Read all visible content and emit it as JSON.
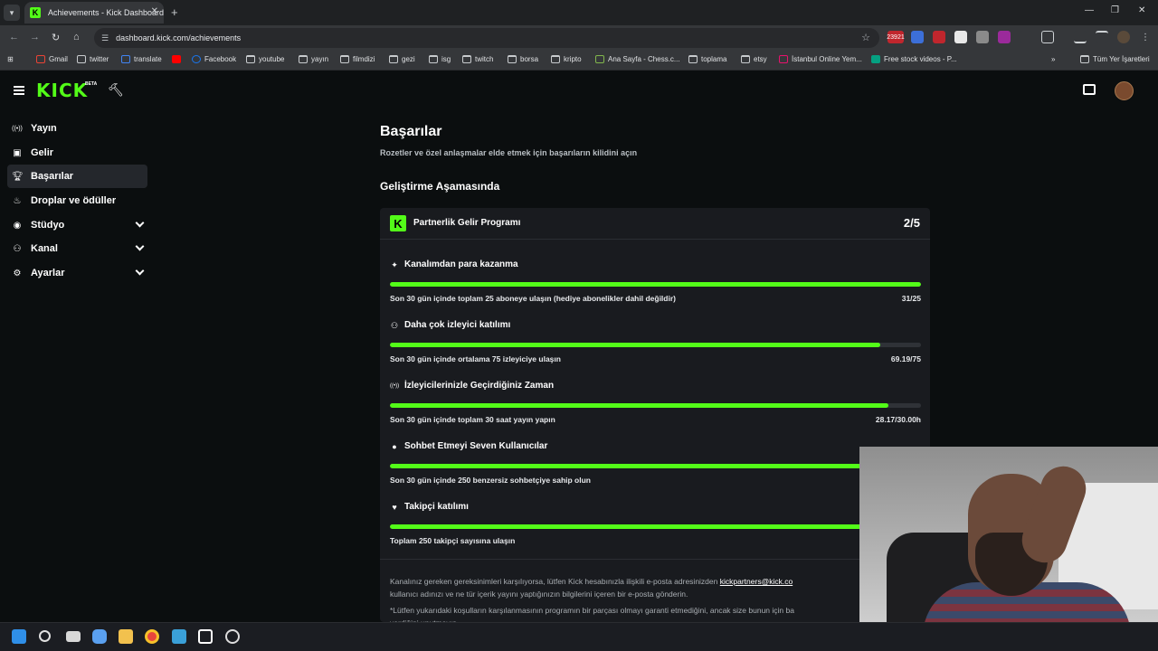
{
  "browser": {
    "tab_title": "Achievements - Kick Dashboard",
    "url": "dashboard.kick.com/achievements",
    "new_tab": "+",
    "close": "✕",
    "window_controls": [
      "—",
      "❐",
      "✕"
    ],
    "extension_badge": "23921",
    "bookmarks": [
      {
        "label": "Gmail",
        "icon": "gmail-icon"
      },
      {
        "label": "twitter",
        "icon": "x-icon"
      },
      {
        "label": "translate",
        "icon": "translate-icon"
      },
      {
        "label": "",
        "icon": "youtube-icon"
      },
      {
        "label": "Facebook",
        "icon": "facebook-icon"
      },
      {
        "label": "youtube",
        "icon": "folder-icon"
      },
      {
        "label": "yayın",
        "icon": "folder-icon"
      },
      {
        "label": "filmdizi",
        "icon": "folder-icon"
      },
      {
        "label": "gezi",
        "icon": "folder-icon"
      },
      {
        "label": "isg",
        "icon": "folder-icon"
      },
      {
        "label": "twitch",
        "icon": "folder-icon"
      },
      {
        "label": "borsa",
        "icon": "folder-icon"
      },
      {
        "label": "kripto",
        "icon": "folder-icon"
      },
      {
        "label": "Ana Sayfa - Chess.c...",
        "icon": "chess-icon"
      },
      {
        "label": "toplama",
        "icon": "folder-icon"
      },
      {
        "label": "etsy",
        "icon": "folder-icon"
      },
      {
        "label": "İstanbul Online Yem...",
        "icon": "yemek-icon"
      },
      {
        "label": "Free stock videos - P...",
        "icon": "pexels-icon"
      }
    ],
    "all_bookmarks": "Tüm Yer İşaretleri",
    "overflow": "»"
  },
  "kick": {
    "logo": "KICK",
    "beta": "BETA",
    "sidebar": [
      {
        "label": "Yayın",
        "icon": "broadcast-icon",
        "glyph": "((•))",
        "expandable": false,
        "active": false
      },
      {
        "label": "Gelir",
        "icon": "revenue-icon",
        "glyph": "▣",
        "expandable": false,
        "active": false
      },
      {
        "label": "Başarılar",
        "icon": "trophy-icon",
        "glyph": "🏆︎",
        "expandable": false,
        "active": true
      },
      {
        "label": "Droplar ve ödüller",
        "icon": "gift-icon",
        "glyph": "♨",
        "expandable": false,
        "active": false
      },
      {
        "label": "Stüdyo",
        "icon": "studio-icon",
        "glyph": "◉",
        "expandable": true,
        "active": false
      },
      {
        "label": "Kanal",
        "icon": "channel-icon",
        "glyph": "⚇",
        "expandable": true,
        "active": false
      },
      {
        "label": "Ayarlar",
        "icon": "settings-icon",
        "glyph": "⚙",
        "expandable": true,
        "active": false
      }
    ],
    "page_title": "Başarılar",
    "page_subtitle": "Rozetler ve özel anlaşmalar elde etmek için başarıların kilidini açın",
    "section_title": "Geliştirme Aşamasında",
    "program": {
      "badge": "K",
      "title": "Partnerlik Gelir Programı",
      "progress": "2/5",
      "achievements": [
        {
          "title": "Kanalımdan para kazanma",
          "icon": "sparkle-icon",
          "glyph": "✦",
          "desc": "Son 30 gün içinde toplam 25 aboneye ulaşın (hediye abonelikler dahil değildir)",
          "value": "31/25",
          "fraction": 1.0
        },
        {
          "title": "Daha çok izleyici katılımı",
          "icon": "viewers-icon",
          "glyph": "⚇",
          "desc": "Son 30 gün içinde ortalama 75 izleyiciye ulaşın",
          "value": "69.19/75",
          "fraction": 0.9225
        },
        {
          "title": "İzleyicilerinizle Geçirdiğiniz Zaman",
          "icon": "broadcast-icon",
          "glyph": "((•))",
          "desc": "Son 30 gün içinde toplam 30 saat yayın yapın",
          "value": "28.17/30.00h",
          "fraction": 0.939
        },
        {
          "title": "Sohbet Etmeyi Seven Kullanıcılar",
          "icon": "chat-icon",
          "glyph": "●",
          "desc": "Son 30 gün içinde 250 benzersiz sohbetçiye sahip olun",
          "value": "",
          "fraction": 1.0
        },
        {
          "title": "Takipçi katılımı",
          "icon": "heart-icon",
          "glyph": "♥",
          "desc": "Toplam 250 takipçi sayısına ulaşın",
          "value": "",
          "fraction": 1.0
        }
      ],
      "footer_1a": "Kanalınız gereken gereksinimleri karşılıyorsa, lütfen Kick hesabınızla ilişkili e-posta adresinizden",
      "footer_link": "kickpartners@kick.co",
      "footer_1b": "kullanıcı adınızı ve ne tür içerik yayını yaptığınızın bilgilerini içeren bir e-posta gönderin.",
      "footer_2": "*Lütfen yukarıdaki koşulların karşılanmasının programın bir parçası olmayı garanti etmediğini, ancak size bunun için ba",
      "footer_3": "verdiğini unutmayın."
    }
  },
  "taskbar": {
    "icons": [
      "windows-start-icon",
      "search-icon",
      "task-view-icon",
      "copilot-icon",
      "file-explorer-icon",
      "chrome-icon",
      "store-icon",
      "tradingview-icon",
      "app-icon"
    ]
  }
}
